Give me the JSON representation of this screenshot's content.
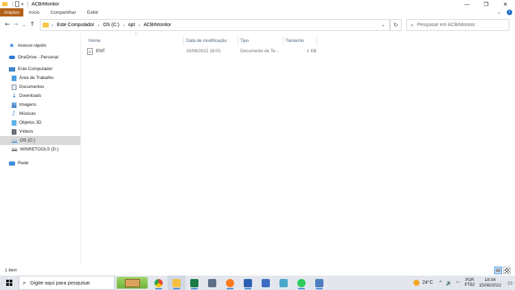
{
  "window": {
    "title": "ACBrMonitor",
    "controls": {
      "minimize": "—",
      "maximize": "❐",
      "close": "✕"
    }
  },
  "ribbon": {
    "tabs": [
      "Arquivo",
      "Início",
      "Compartilhar",
      "Exibir"
    ],
    "expand_glyph": "⌄",
    "help_glyph": "?"
  },
  "address": {
    "crumbs": [
      "Este Computador",
      "OS (C:)",
      "opt",
      "ACBrMonitor"
    ],
    "separator": "›",
    "dropdown_glyph": "⌄",
    "refresh_glyph": "↻"
  },
  "nav_buttons": {
    "back": "←",
    "forward": "→",
    "recent": "⌄",
    "up": "↑"
  },
  "search": {
    "placeholder": "Pesquisar em ACBrMonitor",
    "icon_glyph": "⌕"
  },
  "navpane": {
    "items": [
      {
        "label": "Acesso rápido",
        "icon": "star-icon"
      },
      {
        "label": "OneDrive - Personal",
        "icon": "cloud-icon"
      },
      {
        "label": "Este Computador",
        "icon": "computer-icon"
      },
      {
        "label": "Área de Trabalho",
        "icon": "desktop-icon"
      },
      {
        "label": "Documentos",
        "icon": "documents-icon"
      },
      {
        "label": "Downloads",
        "icon": "download-icon"
      },
      {
        "label": "Imagens",
        "icon": "pictures-icon"
      },
      {
        "label": "Músicas",
        "icon": "music-icon"
      },
      {
        "label": "Objetos 3D",
        "icon": "cube-icon"
      },
      {
        "label": "Vídeos",
        "icon": "video-icon"
      },
      {
        "label": "OS (C:)",
        "icon": "drive-icon"
      },
      {
        "label": "WINRETOOLS (D:)",
        "icon": "usb-drive-icon"
      },
      {
        "label": "Rede",
        "icon": "network-icon"
      }
    ],
    "selected": "OS (C:)"
  },
  "filelist": {
    "columns": [
      "Nome",
      "Data de modificação",
      "Tipo",
      "Tamanho"
    ],
    "sort_glyph": "^",
    "rows": [
      {
        "name": "ENT",
        "modified": "15/08/2022 18:01",
        "type": "Documento de Te...",
        "size": "1 KB"
      }
    ]
  },
  "status": {
    "count": "1 item"
  },
  "taskbar": {
    "search_placeholder": "Digite aqui para pesquisar",
    "search_glyph": "⌕",
    "apps": [
      {
        "name": "chrome",
        "color": "#e9463a"
      },
      {
        "name": "file-explorer",
        "color": "#f5c041"
      },
      {
        "name": "excel",
        "color": "#1e7a45"
      },
      {
        "name": "calculator",
        "color": "#5b6f86"
      },
      {
        "name": "firefox",
        "color": "#ff7b1c"
      },
      {
        "name": "word",
        "color": "#2b5fb4"
      },
      {
        "name": "app-blue",
        "color": "#3c6bc4"
      },
      {
        "name": "app-cyan",
        "color": "#4aa7c9"
      },
      {
        "name": "whatsapp",
        "color": "#2ecc5a"
      },
      {
        "name": "app-monitor",
        "color": "#4d7fbf"
      }
    ],
    "weather": "24°C",
    "tray_glyphs": {
      "chevron": "^",
      "volume": "🔊",
      "wifi": "◠",
      "notification": "▭"
    },
    "lang": [
      "POR",
      "PTB2"
    ],
    "time": "18:04",
    "date": "15/08/2022"
  },
  "colors": {
    "file_tab": "#b3621a",
    "selection": "#cce8ff",
    "taskbar": "#e3e7ed",
    "folder": "#f7c74a"
  }
}
